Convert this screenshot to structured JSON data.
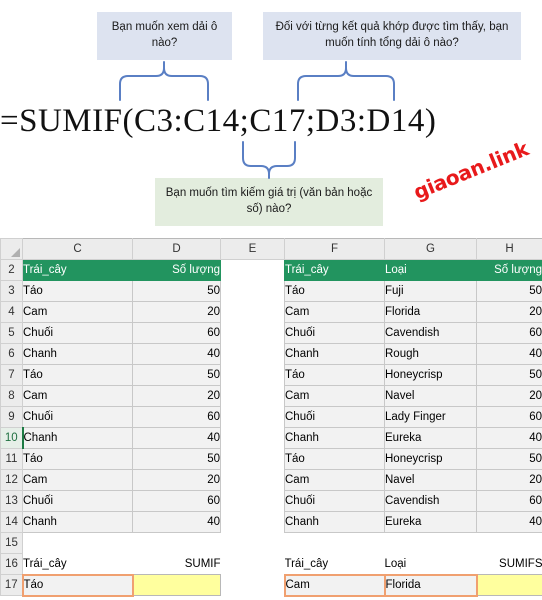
{
  "callouts": {
    "range": "Bạn muốn xem dải ô nào?",
    "sum_range": "Đối với từng kết quả khớp được tìm thấy, bạn muốn tính tổng dải ô nào?",
    "criteria": "Bạn muốn tìm kiếm giá trị (văn bản hoặc số) nào?"
  },
  "formula": {
    "text": "=SUMIF(C3:C14;C17;D3:D14)"
  },
  "watermark": {
    "text": "giaoan.link",
    "color": "#e8191b"
  },
  "colors": {
    "callout_blue": "#dde3f0",
    "callout_green": "#e3edde",
    "brace": "#5a7fc4",
    "header_green": "#22945f",
    "input_border": "#f0a070",
    "result_yellow": "#ffff9e",
    "active_row": "#1c7a43"
  },
  "sheet": {
    "columns": [
      "C",
      "D",
      "E",
      "F",
      "G",
      "H"
    ],
    "active_row": "10",
    "header_row": {
      "number": "2",
      "cells": [
        "Trái_cây",
        "Số lượng",
        "",
        "Trái_cây",
        "Loại",
        "Số lượng"
      ]
    },
    "rows": [
      {
        "number": "3",
        "cells": [
          "Táo",
          "50",
          "",
          "Táo",
          "Fuji",
          "50"
        ]
      },
      {
        "number": "4",
        "cells": [
          "Cam",
          "20",
          "",
          "Cam",
          "Florida",
          "20"
        ]
      },
      {
        "number": "5",
        "cells": [
          "Chuối",
          "60",
          "",
          "Chuối",
          "Cavendish",
          "60"
        ]
      },
      {
        "number": "6",
        "cells": [
          "Chanh",
          "40",
          "",
          "Chanh",
          "Rough",
          "40"
        ]
      },
      {
        "number": "7",
        "cells": [
          "Táo",
          "50",
          "",
          "Táo",
          "Honeycrisp",
          "50"
        ]
      },
      {
        "number": "8",
        "cells": [
          "Cam",
          "20",
          "",
          "Cam",
          "Navel",
          "20"
        ]
      },
      {
        "number": "9",
        "cells": [
          "Chuối",
          "60",
          "",
          "Chuối",
          "Lady Finger",
          "60"
        ]
      },
      {
        "number": "10",
        "cells": [
          "Chanh",
          "40",
          "",
          "Chanh",
          "Eureka",
          "40"
        ]
      },
      {
        "number": "11",
        "cells": [
          "Táo",
          "50",
          "",
          "Táo",
          "Honeycrisp",
          "50"
        ]
      },
      {
        "number": "12",
        "cells": [
          "Cam",
          "20",
          "",
          "Cam",
          "Navel",
          "20"
        ]
      },
      {
        "number": "13",
        "cells": [
          "Chuối",
          "60",
          "",
          "Chuối",
          "Cavendish",
          "60"
        ]
      },
      {
        "number": "14",
        "cells": [
          "Chanh",
          "40",
          "",
          "Chanh",
          "Eureka",
          "40"
        ]
      }
    ],
    "empty_row": {
      "number": "15"
    },
    "label_row": {
      "number": "16",
      "cells": [
        "Trái_cây",
        "SUMIF",
        "",
        "Trái_cây",
        "Loại",
        "SUMIFS"
      ]
    },
    "input_row": {
      "number": "17",
      "cells": [
        "Táo",
        "",
        "",
        "Cam",
        "Florida",
        ""
      ]
    }
  }
}
